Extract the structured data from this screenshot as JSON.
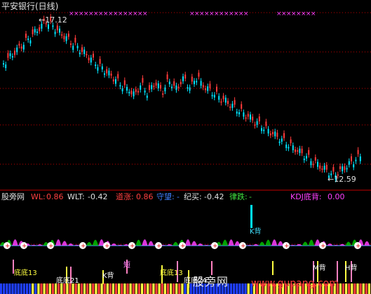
{
  "window": {
    "title": "平安银行(日线)"
  },
  "price": {
    "high_label": "17.12",
    "low_label": "12.59"
  },
  "indicator": {
    "name": "股旁网",
    "wl_label": "WL:",
    "wl_value": "0.86",
    "wlt_label": "WLT:",
    "wlt_value": "-0.42",
    "zhang_label": "道涨:",
    "zhang_value": "0.86",
    "shouwang_label": "守望:",
    "shouwang_value": "-",
    "jimai_label": "纪买:",
    "jimai_value": "-0.42",
    "diedie_label": "律跌:",
    "diedie_value": "-",
    "kdj_label": "KDJ底背:",
    "kdj_value": "0.00"
  },
  "signals": {
    "k_bei": "K背",
    "dibi_13": "底底13",
    "dibi_21": "底底21",
    "duan": "短",
    "k_bei_2": "K背",
    "dibi_13_b": "底底13",
    "dibi_24": "底底24",
    "m_bei": "M背",
    "h_bei": "H背"
  },
  "watermark": {
    "text": "股旁网",
    "url": "www.gupang.com"
  },
  "colors": {
    "up": "#ff3b3b",
    "down": "#00e5ff",
    "axis": "#c00000",
    "magenta": "#ff40ff",
    "pink": "#ff80c0",
    "yellow": "#ffff40",
    "blue": "#2040ff",
    "green": "#00c000"
  }
}
